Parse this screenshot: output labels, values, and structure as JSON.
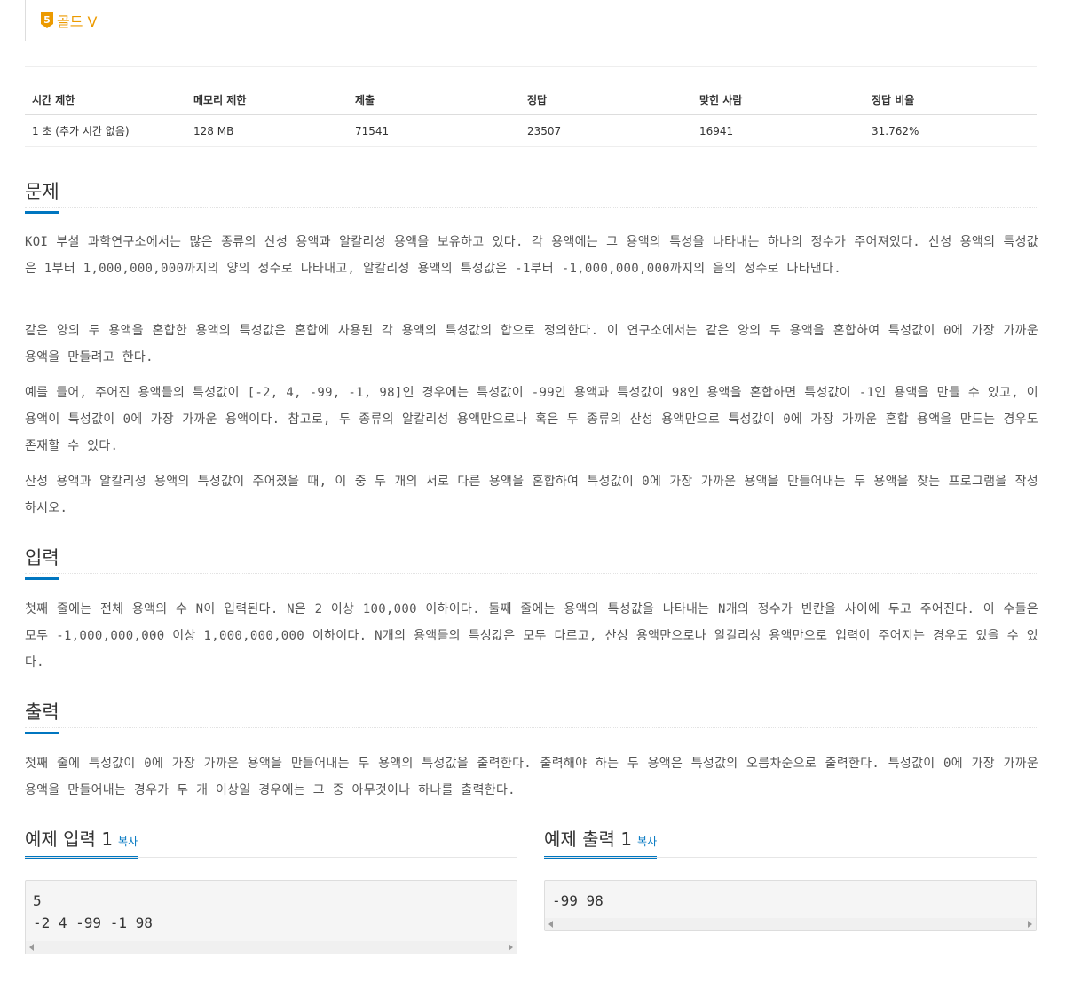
{
  "tier": {
    "badge": "5",
    "name": "골드 V",
    "color": "#ec9a00"
  },
  "info_table": {
    "headers": [
      "시간 제한",
      "메모리 제한",
      "제출",
      "정답",
      "맞힌 사람",
      "정답 비율"
    ],
    "row": [
      "1 초 (추가 시간 없음)",
      "128 MB",
      "71541",
      "23507",
      "16941",
      "31.762%"
    ]
  },
  "problem": {
    "title": "문제",
    "paragraphs": [
      "KOI 부설 과학연구소에서는 많은 종류의 산성 용액과 알칼리성 용액을 보유하고 있다. 각 용액에는 그 용액의 특성을 나타내는 하나의 정수가 주어져있다. 산성 용액의 특성값은 1부터 1,000,000,000까지의 양의 정수로 나타내고, 알칼리성 용액의 특성값은 -1부터 -1,000,000,000까지의 음의 정수로 나타낸다.",
      "같은 양의 두 용액을 혼합한 용액의 특성값은 혼합에 사용된 각 용액의 특성값의 합으로 정의한다. 이 연구소에서는 같은 양의 두 용액을 혼합하여 특성값이 0에 가장 가까운 용액을 만들려고 한다.",
      "예를 들어, 주어진 용액들의 특성값이 [-2, 4, -99, -1, 98]인 경우에는 특성값이 -99인 용액과 특성값이 98인 용액을 혼합하면 특성값이 -1인 용액을 만들 수 있고, 이 용액이 특성값이 0에 가장 가까운 용액이다. 참고로, 두 종류의 알칼리성 용액만으로나 혹은 두 종류의 산성 용액만으로 특성값이 0에 가장 가까운 혼합 용액을 만드는 경우도 존재할 수 있다.",
      "산성 용액과 알칼리성 용액의 특성값이 주어졌을 때, 이 중 두 개의 서로 다른 용액을 혼합하여 특성값이 0에 가장 가까운 용액을 만들어내는 두 용액을 찾는 프로그램을 작성하시오."
    ]
  },
  "input": {
    "title": "입력",
    "paragraph": "첫째 줄에는 전체 용액의 수 N이 입력된다. N은 2 이상 100,000 이하이다. 둘째 줄에는 용액의 특성값을 나타내는 N개의 정수가 빈칸을 사이에 두고 주어진다. 이 수들은 모두 -1,000,000,000 이상 1,000,000,000 이하이다. N개의 용액들의 특성값은 모두 다르고, 산성 용액만으로나 알칼리성 용액만으로 입력이 주어지는 경우도 있을 수 있다."
  },
  "output": {
    "title": "출력",
    "paragraph": "첫째 줄에 특성값이 0에 가장 가까운 용액을 만들어내는 두 용액의 특성값을 출력한다. 출력해야 하는 두 용액은 특성값의 오름차순으로 출력한다. 특성값이 0에 가장 가까운 용액을 만들어내는 경우가 두 개 이상일 경우에는 그 중 아무것이나 하나를 출력한다."
  },
  "samples": {
    "input_title": "예제 입력 1",
    "output_title": "예제 출력 1",
    "copy_label": "복사",
    "input_text": "5\n-2 4 -99 -1 98",
    "output_text": "-99 98"
  },
  "colors": {
    "accent": "#0076c0",
    "tier": "#ec9a00"
  }
}
